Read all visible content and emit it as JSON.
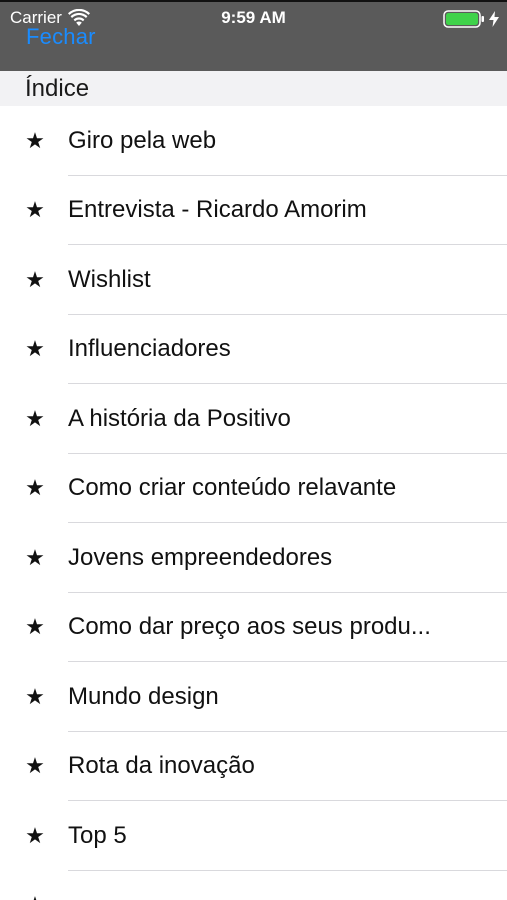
{
  "status_bar": {
    "carrier": "Carrier",
    "time": "9:59 AM",
    "battery_color": "#3fd24a"
  },
  "nav": {
    "close_label": "Fechar",
    "accent_color": "#1a8cff"
  },
  "section": {
    "title": "Índice"
  },
  "items": [
    {
      "icon": "star-icon",
      "label": "Giro pela web"
    },
    {
      "icon": "star-icon",
      "label": "Entrevista - Ricardo Amorim"
    },
    {
      "icon": "star-icon",
      "label": "Wishlist"
    },
    {
      "icon": "star-icon",
      "label": "Influenciadores"
    },
    {
      "icon": "star-icon",
      "label": "A história da Positivo"
    },
    {
      "icon": "star-icon",
      "label": "Como criar conteúdo relavante"
    },
    {
      "icon": "star-icon",
      "label": "Jovens empreendedores"
    },
    {
      "icon": "star-icon",
      "label": "Como dar preço aos seus produ..."
    },
    {
      "icon": "star-icon",
      "label": "Mundo design"
    },
    {
      "icon": "star-icon",
      "label": "Rota da inovação"
    },
    {
      "icon": "star-icon",
      "label": "Top 5"
    },
    {
      "icon": "star-icon",
      "label": ""
    }
  ]
}
